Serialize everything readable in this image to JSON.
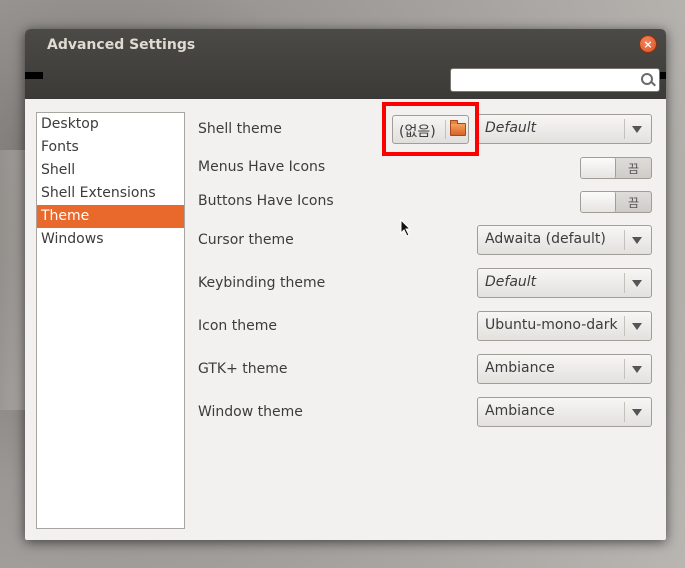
{
  "window": {
    "title": "Advanced Settings",
    "close_glyph": "×"
  },
  "search": {
    "value": "",
    "placeholder": ""
  },
  "sidebar": {
    "items": [
      {
        "label": "Desktop"
      },
      {
        "label": "Fonts"
      },
      {
        "label": "Shell"
      },
      {
        "label": "Shell Extensions"
      },
      {
        "label": "Theme",
        "selected": true
      },
      {
        "label": "Windows"
      }
    ]
  },
  "settings": {
    "shell_theme": {
      "label": "Shell theme",
      "file_button": "(없음)",
      "value": "Default"
    },
    "menus_have_icons": {
      "label": "Menus Have Icons",
      "state": "끔"
    },
    "buttons_have_icons": {
      "label": "Buttons Have Icons",
      "state": "끔"
    },
    "cursor_theme": {
      "label": "Cursor theme",
      "value": "Adwaita (default)"
    },
    "keybinding_theme": {
      "label": "Keybinding theme",
      "value": "Default"
    },
    "icon_theme": {
      "label": "Icon theme",
      "value": "Ubuntu-mono-dark"
    },
    "gtk_theme": {
      "label": "GTK+ theme",
      "value": "Ambiance"
    },
    "window_theme": {
      "label": "Window theme",
      "value": "Ambiance"
    }
  },
  "colors": {
    "accent": "#e8692b",
    "highlight": "#ff0000",
    "titlebar": "#3c3b37"
  }
}
